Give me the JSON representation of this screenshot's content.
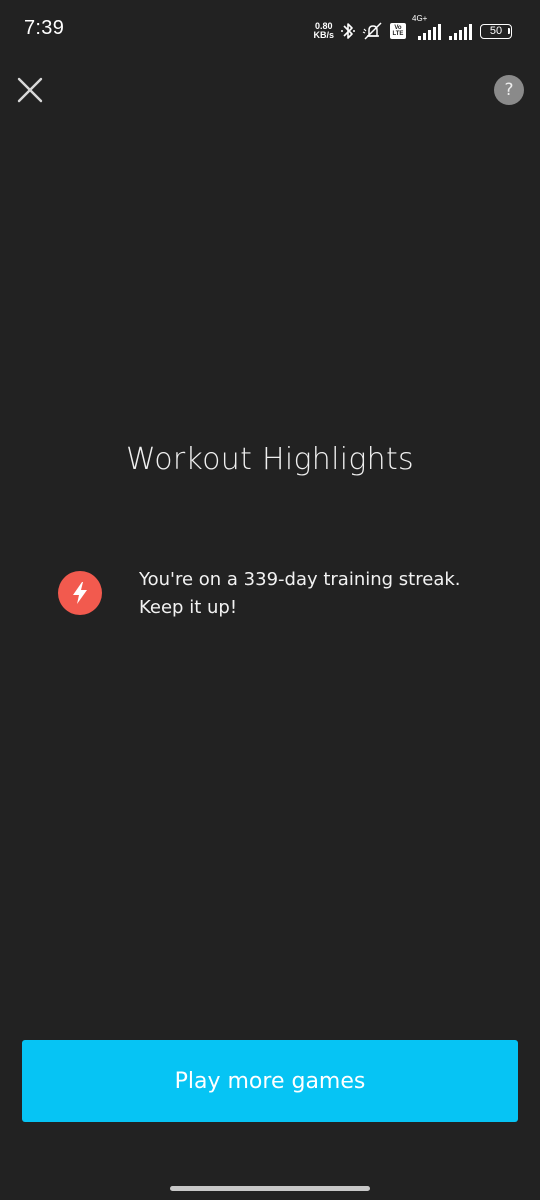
{
  "status_bar": {
    "time": "7:39",
    "net_speed_value": "0.80",
    "net_speed_unit": "KB/s",
    "volte_top": "Vo",
    "volte_bottom": "LTE",
    "network_label": "4G+",
    "battery_level": "50",
    "icons": [
      "bluetooth-icon",
      "mute-icon",
      "volte-icon",
      "signal-icon",
      "signal-icon",
      "battery-icon"
    ]
  },
  "header": {
    "close_icon": "close-icon",
    "help_label": "?"
  },
  "main": {
    "title": "Workout Highlights",
    "highlights": [
      {
        "icon": "lightning-icon",
        "icon_color": "#f25a4e",
        "line1": "You're on a 339-day training streak.",
        "line2": "Keep it up!"
      }
    ]
  },
  "footer": {
    "primary_button": "Play more games",
    "primary_color": "#06c4f4"
  },
  "colors": {
    "background": "#222222",
    "accent": "#06c4f4",
    "streak": "#f25a4e"
  }
}
